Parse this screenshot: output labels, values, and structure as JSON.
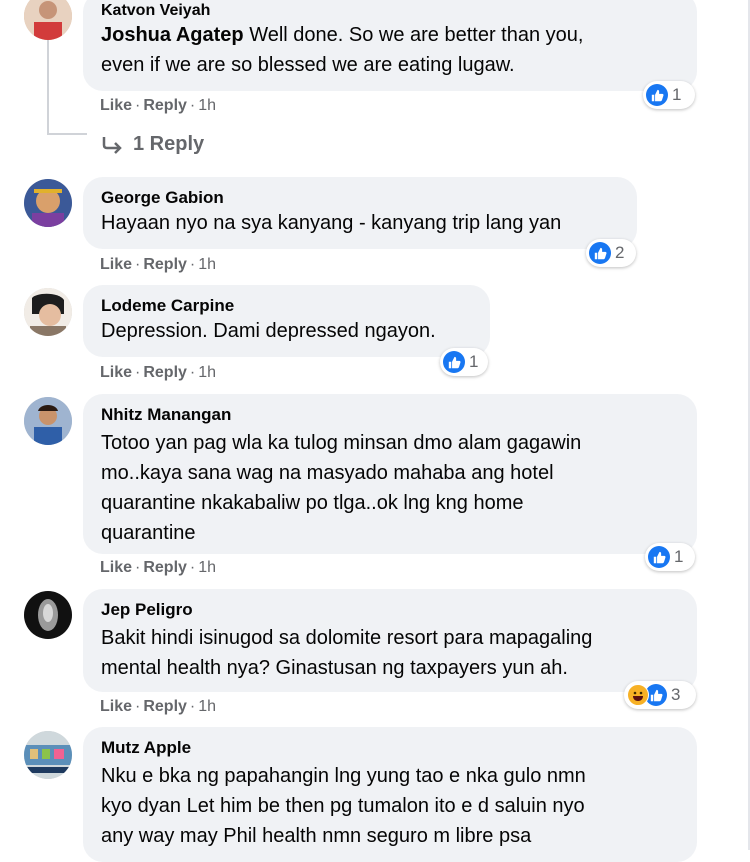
{
  "comments": [
    {
      "author": "Katvon Veiyah",
      "mention": "Joshua Agatep",
      "text_line1": "Well done. So we are better than you,",
      "text_line2": "even if we are so blessed we are eating lugaw.",
      "like": "Like",
      "reply": "Reply",
      "time": "1h",
      "reaction_count": "1",
      "replies_link": "1 Reply"
    },
    {
      "author": "George Gabion",
      "text_line1": "Hayaan nyo na sya kanyang - kanyang trip lang yan",
      "like": "Like",
      "reply": "Reply",
      "time": "1h",
      "reaction_count": "2"
    },
    {
      "author": "Lodeme Carpine",
      "text_line1": "Depression. Dami depressed ngayon.",
      "like": "Like",
      "reply": "Reply",
      "time": "1h",
      "reaction_count": "1"
    },
    {
      "author": "Nhitz Manangan",
      "text_line1": "Totoo yan pag wla ka tulog minsan dmo alam gagawin",
      "text_line2": "mo..kaya sana wag na masyado mahaba ang hotel",
      "text_line3": "quarantine nkakabaliw po tlga..ok lng kng home",
      "text_line4": "quarantine",
      "like": "Like",
      "reply": "Reply",
      "time": "1h",
      "reaction_count": "1"
    },
    {
      "author": "Jep Peligro",
      "text_line1": "Bakit hindi isinugod sa dolomite resort para mapagaling",
      "text_line2": "mental health nya? Ginastusan ng taxpayers yun ah.",
      "like": "Like",
      "reply": "Reply",
      "time": "1h",
      "reaction_count": "3"
    },
    {
      "author": "Mutz Apple",
      "text_line1": "Nku e bka ng papahangin lng yung tao e nka gulo nmn",
      "text_line2": "kyo dyan Let him be then pg tumalon ito e d saluin nyo",
      "text_line3": "any way may Phil health nmn seguro m libre psa"
    }
  ],
  "colors": {
    "bubble": "#f0f2f5",
    "like_blue": "#1877f2",
    "haha_yellow": "#f7b125",
    "meta_gray": "#65676b"
  }
}
